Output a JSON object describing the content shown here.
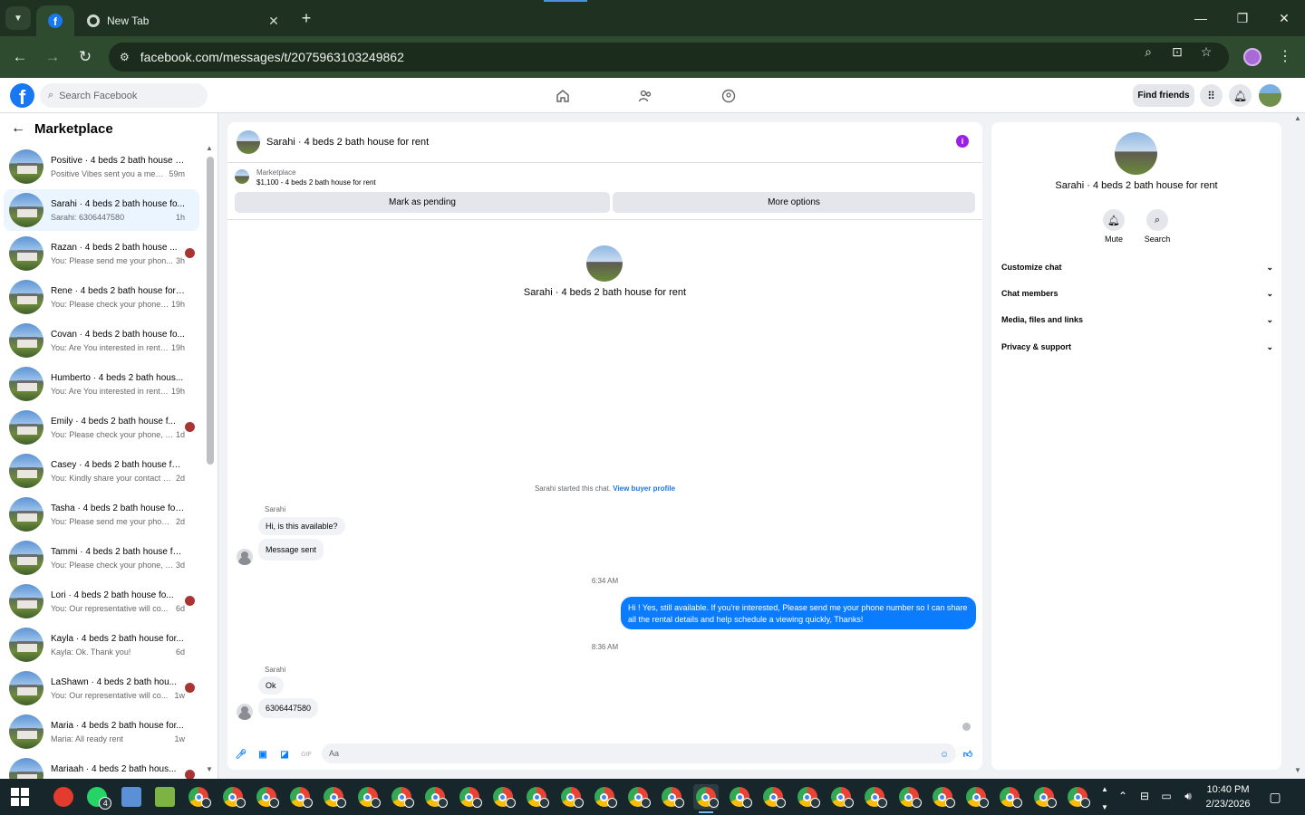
{
  "browser": {
    "tabs": [
      {
        "label": "",
        "icon": "facebook-icon",
        "active": true
      },
      {
        "label": "New Tab",
        "icon": "chrome-icon",
        "active": false
      }
    ],
    "url": "facebook.com/messages/t/2075963103249862"
  },
  "header": {
    "search_placeholder": "Search Facebook",
    "find_friends_label": "Find friends"
  },
  "sidebar": {
    "title": "Marketplace",
    "conversations": [
      {
        "title": "Positive · 4 beds 2 bath house f...",
        "snippet": "Positive Vibes sent you a messa...",
        "time": "59m",
        "active": false,
        "unread_dot": false
      },
      {
        "title": "Sarahi · 4 beds 2 bath house fo...",
        "snippet": "Sarahi: 6306447580",
        "time": "1h",
        "active": true,
        "unread_dot": false
      },
      {
        "title": "Razan · 4 beds 2 bath house ...",
        "snippet": "You: Please send me your phon...",
        "time": "3h",
        "active": false,
        "unread_dot": true
      },
      {
        "title": "Rene · 4 beds 2 bath house for ...",
        "snippet": "You: Please check your phone, I ...",
        "time": "19h",
        "active": false,
        "unread_dot": false
      },
      {
        "title": "Covan · 4 beds 2 bath house fo...",
        "snippet": "You: Are You interested in rentin...",
        "time": "19h",
        "active": false,
        "unread_dot": false
      },
      {
        "title": "Humberto · 4 beds 2 bath hous...",
        "snippet": "You: Are You interested in rentin...",
        "time": "19h",
        "active": false,
        "unread_dot": false
      },
      {
        "title": "Emily · 4 beds 2 bath house f...",
        "snippet": "You: Please check your phone, I...",
        "time": "1d",
        "active": false,
        "unread_dot": true
      },
      {
        "title": "Casey · 4 beds 2 bath house for...",
        "snippet": "You: Kindly share your contact nu...",
        "time": "2d",
        "active": false,
        "unread_dot": false
      },
      {
        "title": "Tasha · 4 beds 2 bath house for...",
        "snippet": "You: Please send me your phone n...",
        "time": "2d",
        "active": false,
        "unread_dot": false
      },
      {
        "title": "Tammi · 4 beds 2 bath house fo...",
        "snippet": "You: Please check your phone, I h...",
        "time": "3d",
        "active": false,
        "unread_dot": false
      },
      {
        "title": "Lori · 4 beds 2 bath house fo...",
        "snippet": "You: Our representative will co...",
        "time": "6d",
        "active": false,
        "unread_dot": true
      },
      {
        "title": "Kayla · 4 beds 2 bath house for...",
        "snippet": "Kayla: Ok. Thank you!",
        "time": "6d",
        "active": false,
        "unread_dot": false
      },
      {
        "title": "LaShawn · 4 beds 2 bath hou...",
        "snippet": "You: Our representative will co...",
        "time": "1w",
        "active": false,
        "unread_dot": true
      },
      {
        "title": "Maria · 4 beds 2 bath house for...",
        "snippet": "Maria: All ready rent",
        "time": "1w",
        "active": false,
        "unread_dot": false
      },
      {
        "title": "Mariaah · 4 beds 2 bath hous...",
        "snippet": "You: Our representative will co...",
        "time": "1w",
        "active": false,
        "unread_dot": true
      }
    ]
  },
  "chat": {
    "title": "Sarahi · 4 beds 2 bath house for rent",
    "listing_source": "Marketplace",
    "listing_price_title": "$1,100 - 4 beds 2 bath house for rent",
    "mark_pending_label": "Mark as pending",
    "more_options_label": "More options",
    "center_name": "Sarahi · 4 beds 2 bath house for rent",
    "started_text": "Sarahi started this chat.",
    "view_buyer_profile": "View buyer profile",
    "messages": [
      {
        "sender": "Sarahi",
        "text": "Hi, is this available?"
      },
      {
        "sender": "",
        "text": "Message sent"
      },
      {
        "timestamp": "6:34 AM"
      },
      {
        "sender": "You",
        "text": "Hi ! Yes, still available. If you're interested, Please send me your phone number so I can share all the rental details and help schedule a viewing quickly, Thanks!"
      },
      {
        "timestamp": "8:36 AM"
      },
      {
        "sender": "Sarahi",
        "text": "Ok"
      },
      {
        "sender": "",
        "text": "6306447580"
      }
    ],
    "composer_placeholder": "Aa"
  },
  "details": {
    "name": "Sarahi · 4 beds 2 bath house for rent",
    "actions": [
      {
        "label": "Mute",
        "icon": "bell-icon"
      },
      {
        "label": "Search",
        "icon": "search-icon"
      }
    ],
    "sections": [
      "Customize chat",
      "Chat members",
      "Media, files and links",
      "Privacy & support"
    ]
  },
  "taskbar": {
    "time": "10:40 PM",
    "date": "2/23/2026",
    "whatsapp_badge": "4"
  },
  "colors": {
    "accent": "#0a7cff",
    "facebook_blue": "#1877f2",
    "browser_frame": "#2e4a2f",
    "taskbar": "#16262a"
  }
}
